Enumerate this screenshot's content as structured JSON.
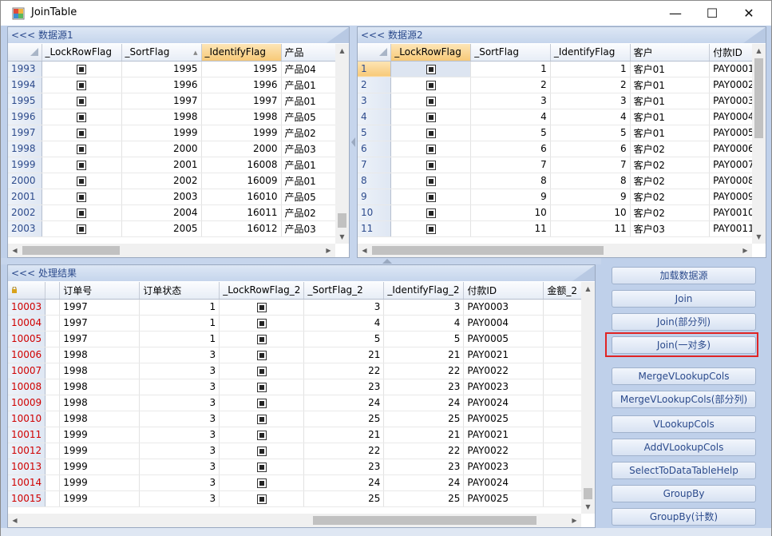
{
  "window": {
    "title": "JoinTable"
  },
  "winbtns": {
    "minimize": "—",
    "maximize": "☐",
    "close": "✕"
  },
  "panel1": {
    "caption": "<<< 数据源1",
    "columns": [
      "_LockRowFlag",
      "_SortFlag",
      "_IdentifyFlag",
      "产品"
    ],
    "rows": [
      [
        "1993",
        "1995",
        "1995",
        "产品04"
      ],
      [
        "1994",
        "1996",
        "1996",
        "产品01"
      ],
      [
        "1995",
        "1997",
        "1997",
        "产品01"
      ],
      [
        "1996",
        "1998",
        "1998",
        "产品05"
      ],
      [
        "1997",
        "1999",
        "1999",
        "产品02"
      ],
      [
        "1998",
        "2000",
        "2000",
        "产品03"
      ],
      [
        "1999",
        "2001",
        "16008",
        "产品01"
      ],
      [
        "2000",
        "2002",
        "16009",
        "产品01"
      ],
      [
        "2001",
        "2003",
        "16010",
        "产品05"
      ],
      [
        "2002",
        "2004",
        "16011",
        "产品02"
      ],
      [
        "2003",
        "2005",
        "16012",
        "产品03"
      ]
    ]
  },
  "panel2": {
    "caption": "<<< 数据源2",
    "columns": [
      "_LockRowFlag",
      "_SortFlag",
      "_IdentifyFlag",
      "客户",
      "付款ID"
    ],
    "rows": [
      [
        "1",
        "1",
        "1",
        "客户01",
        "PAY0001"
      ],
      [
        "2",
        "2",
        "2",
        "客户01",
        "PAY0002"
      ],
      [
        "3",
        "3",
        "3",
        "客户01",
        "PAY0003"
      ],
      [
        "4",
        "4",
        "4",
        "客户01",
        "PAY0004"
      ],
      [
        "5",
        "5",
        "5",
        "客户01",
        "PAY0005"
      ],
      [
        "6",
        "6",
        "6",
        "客户02",
        "PAY0006"
      ],
      [
        "7",
        "7",
        "7",
        "客户02",
        "PAY0007"
      ],
      [
        "8",
        "8",
        "8",
        "客户02",
        "PAY0008"
      ],
      [
        "9",
        "9",
        "9",
        "客户02",
        "PAY0009"
      ],
      [
        "10",
        "10",
        "10",
        "客户02",
        "PAY0010"
      ],
      [
        "11",
        "11",
        "11",
        "客户03",
        "PAY0011"
      ]
    ]
  },
  "panel3": {
    "caption": "<<< 处理结果",
    "columns": [
      "订单号",
      "订单状态",
      "_LockRowFlag_2",
      "_SortFlag_2",
      "_IdentifyFlag_2",
      "付款ID",
      "金额_2"
    ],
    "rows": [
      [
        "10003",
        "1997",
        "1",
        "3",
        "3",
        "PAY0003"
      ],
      [
        "10004",
        "1997",
        "1",
        "4",
        "4",
        "PAY0004"
      ],
      [
        "10005",
        "1997",
        "1",
        "5",
        "5",
        "PAY0005"
      ],
      [
        "10006",
        "1998",
        "3",
        "21",
        "21",
        "PAY0021"
      ],
      [
        "10007",
        "1998",
        "3",
        "22",
        "22",
        "PAY0022"
      ],
      [
        "10008",
        "1998",
        "3",
        "23",
        "23",
        "PAY0023"
      ],
      [
        "10009",
        "1998",
        "3",
        "24",
        "24",
        "PAY0024"
      ],
      [
        "10010",
        "1998",
        "3",
        "25",
        "25",
        "PAY0025"
      ],
      [
        "10011",
        "1999",
        "3",
        "21",
        "21",
        "PAY0021"
      ],
      [
        "10012",
        "1999",
        "3",
        "22",
        "22",
        "PAY0022"
      ],
      [
        "10013",
        "1999",
        "3",
        "23",
        "23",
        "PAY0023"
      ],
      [
        "10014",
        "1999",
        "3",
        "24",
        "24",
        "PAY0024"
      ],
      [
        "10015",
        "1999",
        "3",
        "25",
        "25",
        "PAY0025"
      ]
    ]
  },
  "buttons": [
    "加载数据源",
    "Join",
    "Join(部分列)",
    "Join(一对多)",
    "MergeVLookupCols",
    "MergeVLookupCols(部分列)",
    "VLookupCols",
    "AddVLookupCols",
    "SelectToDataTableHelp",
    "GroupBy",
    "GroupBy(计数)"
  ],
  "colors": {
    "accent": "#2b4a8c",
    "highlight": "#e02424",
    "rowheader_red": "#d00000"
  }
}
